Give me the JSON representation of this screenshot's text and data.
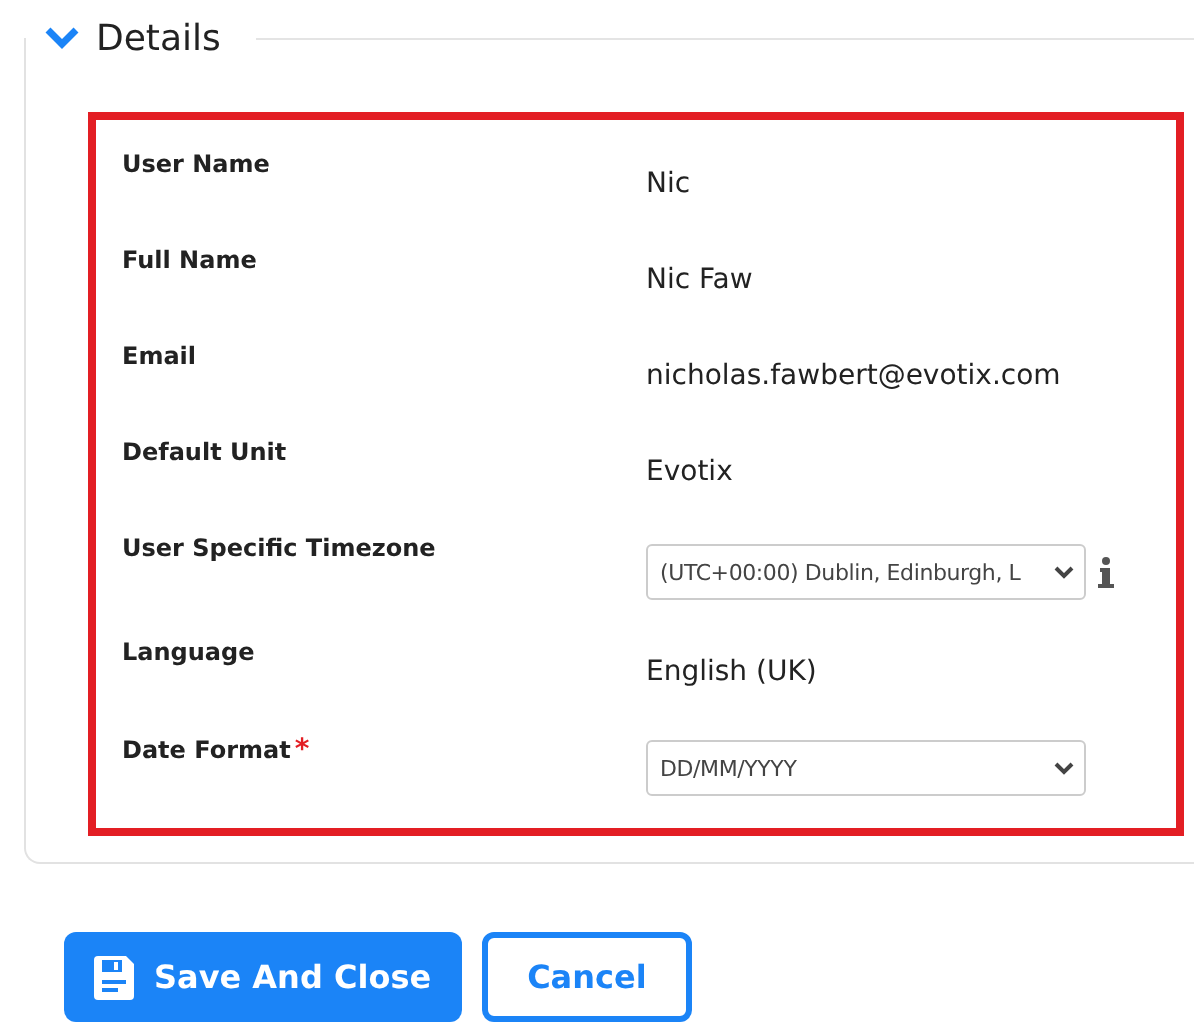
{
  "section": {
    "title": "Details",
    "expanded": true
  },
  "fields": [
    {
      "kind": "text",
      "label": "User Name",
      "value": "Nic"
    },
    {
      "kind": "text",
      "label": "Full Name",
      "value": "Nic Faw"
    },
    {
      "kind": "text",
      "label": "Email",
      "value": "nicholas.fawbert@evotix.com"
    },
    {
      "kind": "text",
      "label": "Default Unit",
      "value": "Evotix"
    },
    {
      "kind": "select",
      "label": "User Specific Timezone",
      "value": "(UTC+00:00) Dublin, Edinburgh, L",
      "info": true
    },
    {
      "kind": "text",
      "label": "Language",
      "value": "English (UK)"
    },
    {
      "kind": "select",
      "label": "Date Format",
      "value": "DD/MM/YYYY",
      "required_mark": "*"
    }
  ],
  "buttons": [
    {
      "kind": "primary",
      "label": "Save And Close"
    },
    {
      "kind": "secondary",
      "label": "Cancel"
    }
  ]
}
